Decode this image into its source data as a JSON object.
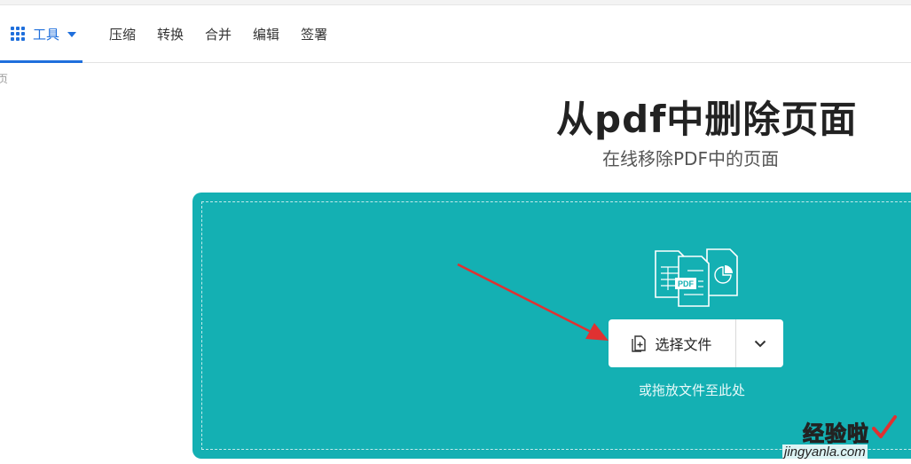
{
  "nav": {
    "tools_label": "工具",
    "links": [
      "压缩",
      "转换",
      "合并",
      "编辑",
      "签署"
    ],
    "accent_color": "#1f6fdc"
  },
  "breadcrumb_fragment": "页",
  "hero": {
    "title": "从pdf中删除页面",
    "subtitle": "在线移除PDF中的页面"
  },
  "upload": {
    "panel_color": "#14b0b3",
    "choose_label": "选择文件",
    "drop_hint": "或拖放文件至此处",
    "icons": [
      "file-plus-icon",
      "chevron-down-icon",
      "document-files-icon"
    ],
    "file_icon_badge": "PDF"
  },
  "annotation": {
    "arrow_color": "#e03131"
  },
  "watermark": {
    "title": "经验啦",
    "url": "jingyanla.com"
  }
}
